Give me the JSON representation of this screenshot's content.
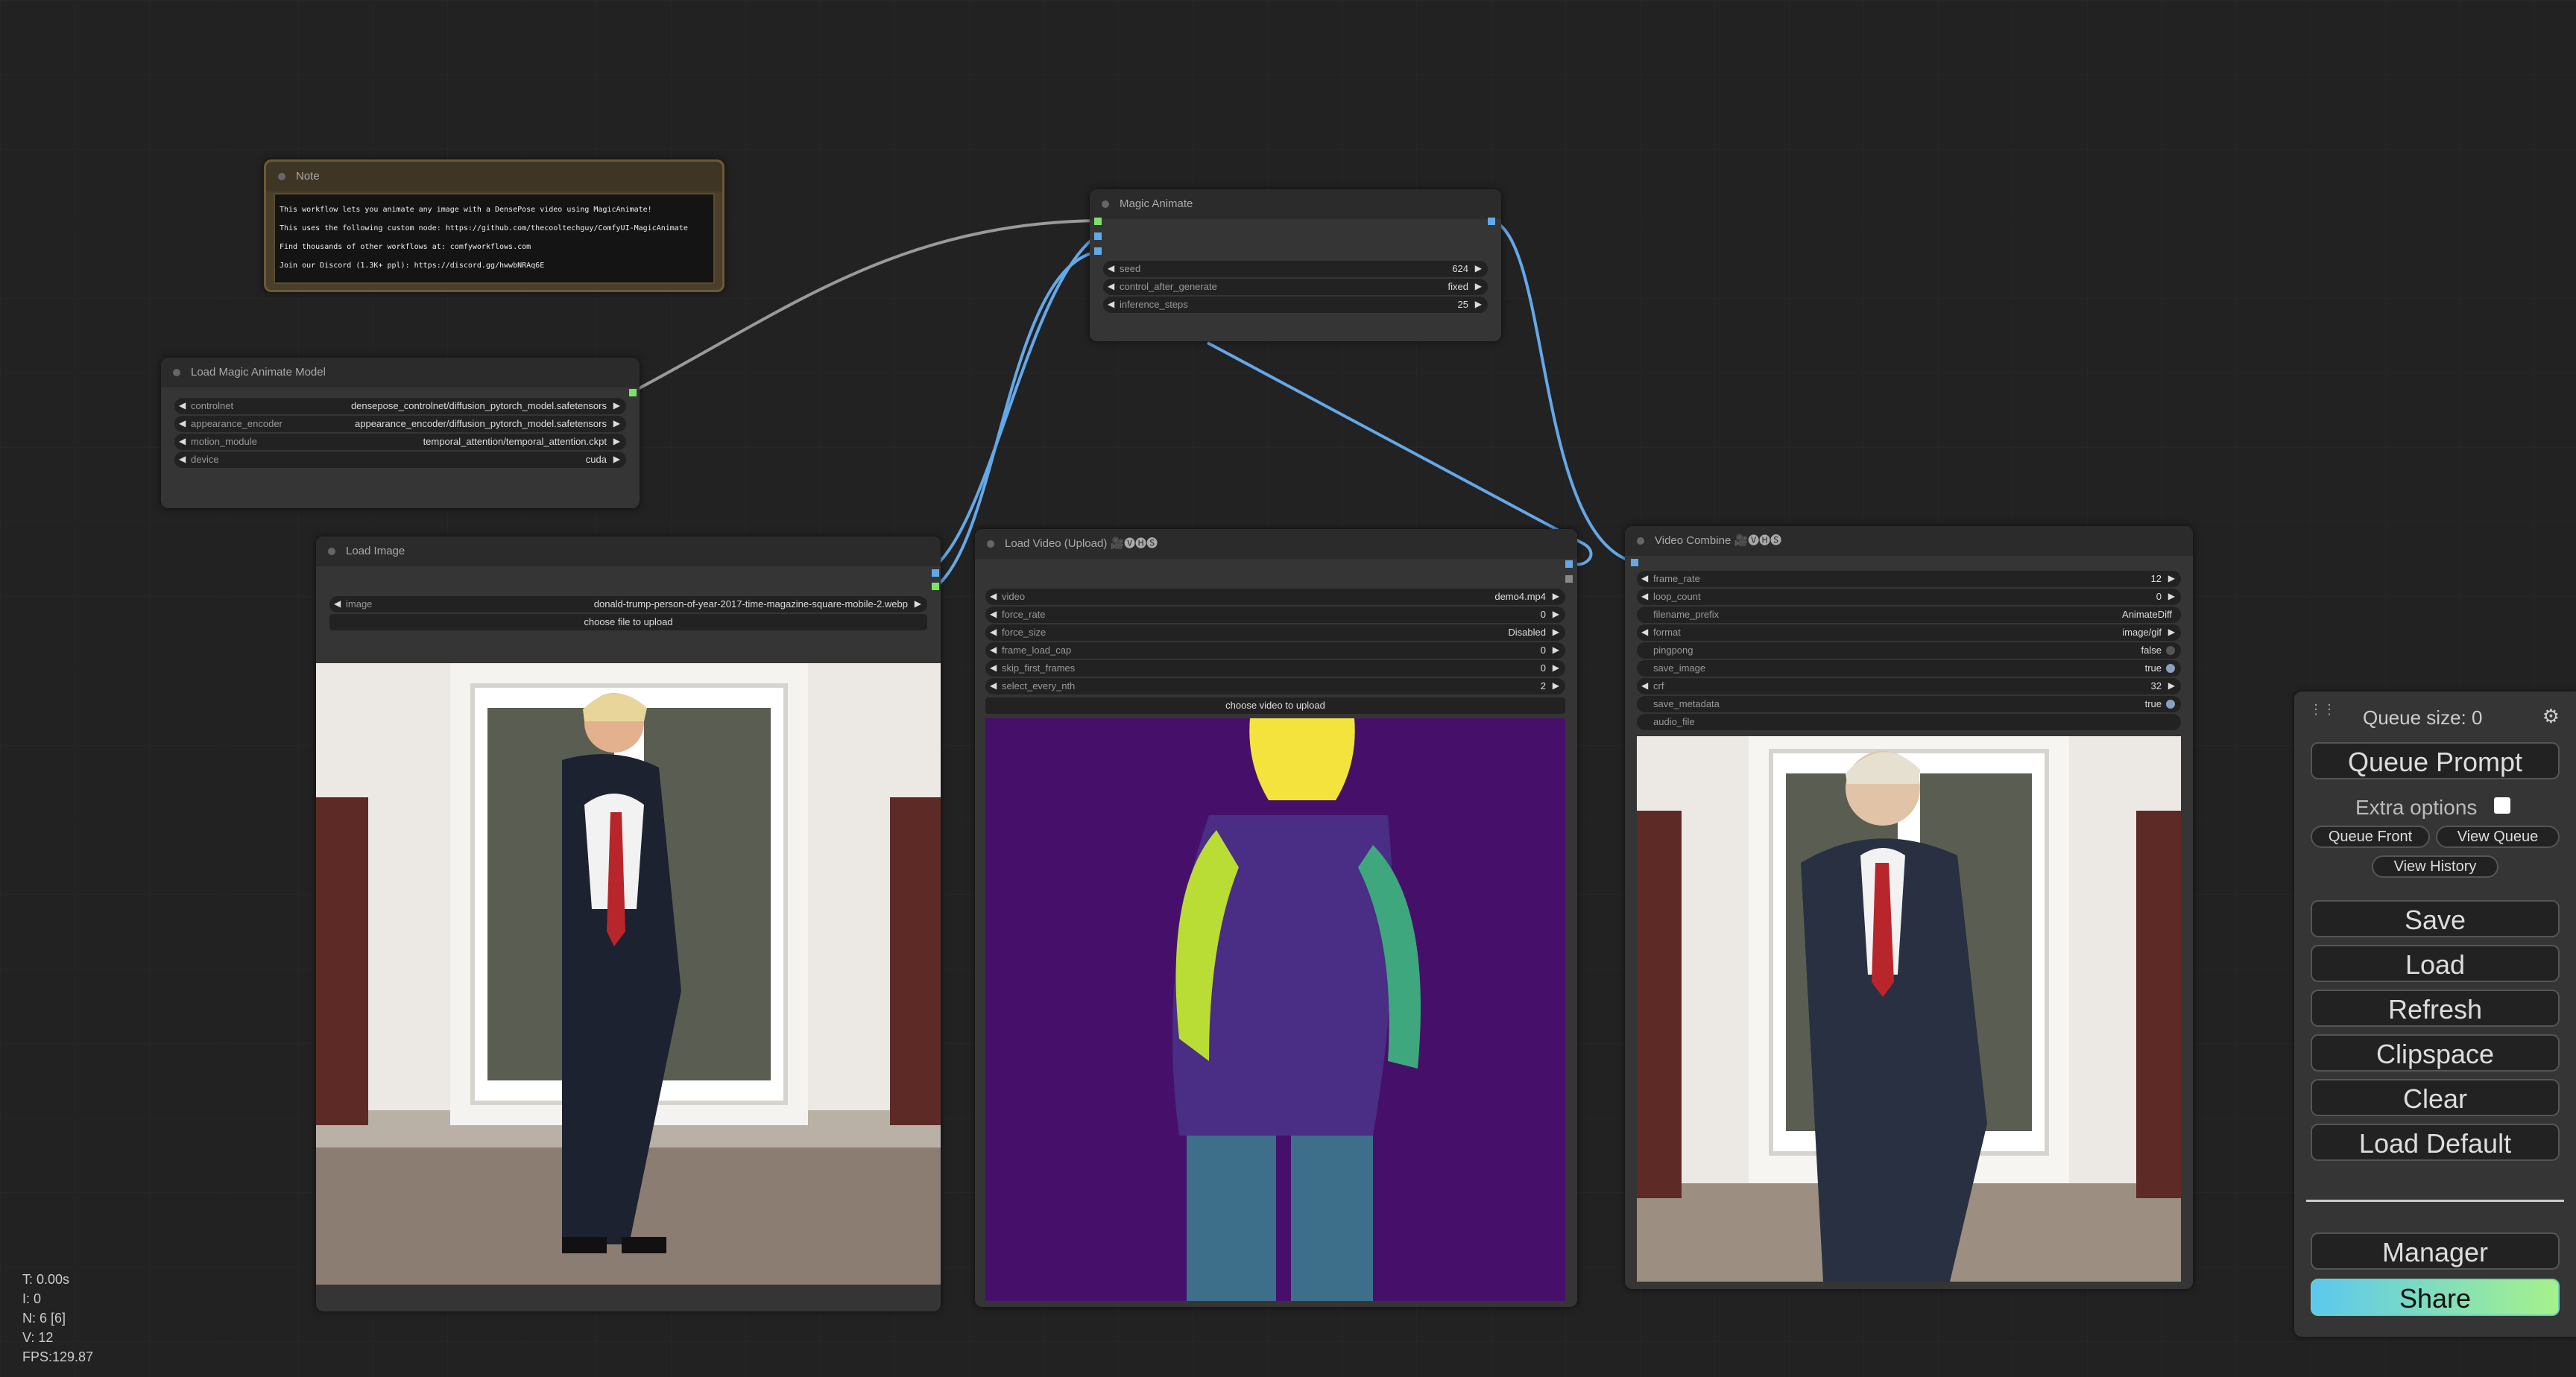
{
  "nodes": {
    "note": {
      "title": "Note",
      "lines": [
        "This workflow lets you animate any image with a DensePose video using MagicAnimate!",
        "This uses the following custom node: https://github.com/thecooltechguy/ComfyUI-MagicAnimate",
        "Find thousands of other workflows at: comfyworkflows.com",
        "Join our Discord (1.3K+ ppl): https://discord.gg/hwwbNRAq6E"
      ]
    },
    "magic_animate": {
      "title": "Magic Animate",
      "widgets": [
        {
          "name": "seed",
          "value": "624"
        },
        {
          "name": "control_after_generate",
          "value": "fixed"
        },
        {
          "name": "inference_steps",
          "value": "25"
        }
      ]
    },
    "load_model": {
      "title": "Load Magic Animate Model",
      "widgets": [
        {
          "name": "controlnet",
          "value": "densepose_controlnet/diffusion_pytorch_model.safetensors"
        },
        {
          "name": "appearance_encoder",
          "value": "appearance_encoder/diffusion_pytorch_model.safetensors"
        },
        {
          "name": "motion_module",
          "value": "temporal_attention/temporal_attention.ckpt"
        },
        {
          "name": "device",
          "value": "cuda"
        }
      ]
    },
    "load_image": {
      "title": "Load Image",
      "widgets": [
        {
          "name": "image",
          "value": "donald-trump-person-of-year-2017-time-magazine-square-mobile-2.webp"
        }
      ],
      "upload_label": "choose file to upload"
    },
    "load_video": {
      "title": "Load Video (Upload) 🎥🅥🅗🅢",
      "widgets": [
        {
          "name": "video",
          "value": "demo4.mp4"
        },
        {
          "name": "force_rate",
          "value": "0"
        },
        {
          "name": "force_size",
          "value": "Disabled"
        },
        {
          "name": "frame_load_cap",
          "value": "0"
        },
        {
          "name": "skip_first_frames",
          "value": "0"
        },
        {
          "name": "select_every_nth",
          "value": "2"
        }
      ],
      "upload_label": "choose video to upload"
    },
    "video_combine": {
      "title": "Video Combine 🎥🅥🅗🅢",
      "widgets": [
        {
          "name": "frame_rate",
          "value": "12"
        },
        {
          "name": "loop_count",
          "value": "0"
        },
        {
          "name": "filename_prefix",
          "value": "AnimateDiff"
        },
        {
          "name": "format",
          "value": "image/gif"
        },
        {
          "name": "pingpong",
          "value": "false"
        },
        {
          "name": "save_image",
          "value": "true"
        },
        {
          "name": "crf",
          "value": "32"
        },
        {
          "name": "save_metadata",
          "value": "true"
        },
        {
          "name": "audio_file",
          "value": ""
        }
      ]
    }
  },
  "stats": {
    "time": "T: 0.00s",
    "iterations": "I: 0",
    "nodes": "N: 6 [6]",
    "vertices": "V: 12",
    "fps": "FPS:129.87"
  },
  "menu": {
    "queue_size": "Queue size: 0",
    "queue_prompt": "Queue Prompt",
    "extra_options": "Extra options",
    "queue_front": "Queue Front",
    "view_queue": "View Queue",
    "view_history": "View History",
    "save": "Save",
    "load": "Load",
    "refresh": "Refresh",
    "clipspace": "Clipspace",
    "clear": "Clear",
    "load_default": "Load Default",
    "manager": "Manager",
    "share": "Share"
  },
  "colors": {
    "link_model": "#9a9a9a",
    "link_image": "#64a8e8",
    "slot_model": "#7ee06a",
    "slot_image": "#64a8e8",
    "share_gradient_start": "#5bc8ef",
    "share_gradient_end": "#a6f28a"
  },
  "icons": [
    "drag-handle-icon",
    "settings-gear-icon"
  ]
}
